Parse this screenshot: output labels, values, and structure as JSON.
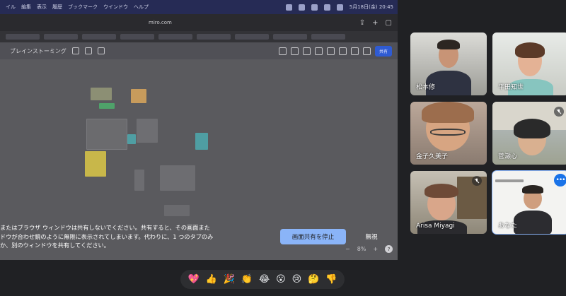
{
  "mac_menu": {
    "items": [
      "イル",
      "編集",
      "表示",
      "履歴",
      "ブックマーク",
      "ウインドウ",
      "ヘルプ"
    ],
    "datetime": "5月18日(金) 20:45"
  },
  "browser": {
    "address": "miro.com"
  },
  "board": {
    "title": "ブレインストーミング",
    "share_label": "共有"
  },
  "share_banner": {
    "message_lines": [
      "またはブラウザ ウィンドウは共有しないでください。共有すると、その画面また",
      "ドウが合わせ鏡のように無限に表示されてしまいます。代わりに、1 つのタブのみ",
      "か、別のウィンドウを共有してください。"
    ],
    "stop_label": "画面共有を停止",
    "ignore_label": "無視"
  },
  "zoom": {
    "minus": "−",
    "level": "8%",
    "plus": "+",
    "help": "?"
  },
  "participants": [
    {
      "name": "松本修",
      "muted": false
    },
    {
      "name": "平田知世",
      "muted": false
    },
    {
      "name": "金子久美子",
      "muted": false
    },
    {
      "name": "菅瀬心",
      "muted": true
    },
    {
      "name": "Arisa Miyagi",
      "muted": true
    },
    {
      "name": "あなた",
      "muted": false
    }
  ],
  "reactions": [
    "💖",
    "👍",
    "🎉",
    "👏",
    "😂",
    "😮",
    "😢",
    "🤔",
    "👎"
  ],
  "colors": {
    "accent": "#8ab4f8",
    "meet_bg": "#202124",
    "menubar": "#262b55"
  }
}
